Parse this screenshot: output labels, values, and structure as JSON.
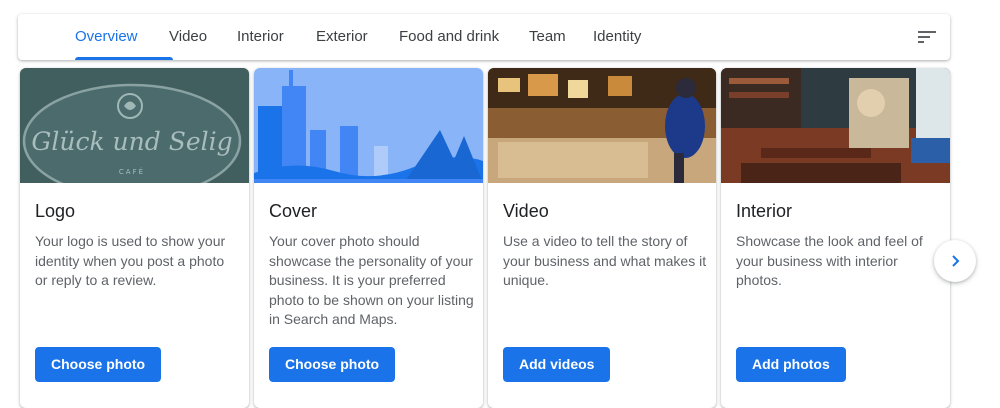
{
  "tabs": [
    {
      "label": "Overview",
      "active": true
    },
    {
      "label": "Video"
    },
    {
      "label": "Interior"
    },
    {
      "label": "Exterior"
    },
    {
      "label": "Food and drink"
    },
    {
      "label": "Team"
    },
    {
      "label": "Identity"
    }
  ],
  "logo_image_text": {
    "line1": "Glück und Selig",
    "line2": "CAFÉ"
  },
  "cards": [
    {
      "title": "Logo",
      "description": "Your logo is used to show your identity when you post a photo or reply to a review.",
      "button": "Choose photo"
    },
    {
      "title": "Cover",
      "description": "Your cover photo should showcase the personality of your business. It is your preferred photo to be shown on your listing in Search and Maps.",
      "button": "Choose photo"
    },
    {
      "title": "Video",
      "description": "Use a video to tell the story of your business and what makes it unique.",
      "button": "Add videos"
    },
    {
      "title": "Interior",
      "description": "Showcase the look and feel of your business with interior photos.",
      "button": "Add photos"
    }
  ],
  "colors": {
    "accent": "#1a73e8",
    "text": "#202124",
    "secondary_text": "#5f6368"
  },
  "icons": {
    "filter": "filter-list-icon",
    "next": "chevron-right-icon"
  }
}
